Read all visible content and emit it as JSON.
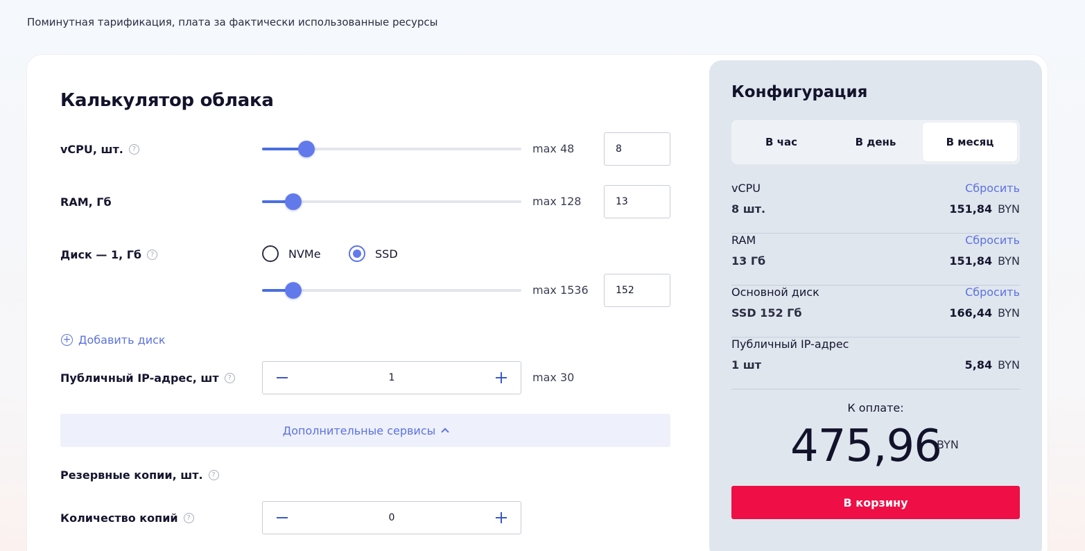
{
  "header": {
    "subtitle": "Поминутная тарификация, плата за фактически использованные ресурсы"
  },
  "calculator": {
    "title": "Калькулятор облака",
    "vcpu": {
      "label": "vCPU, шт.",
      "max": "max 48",
      "value": "8",
      "fraction": 0.17
    },
    "ram": {
      "label": "RAM, Гб",
      "max": "max 128",
      "value": "13",
      "fraction": 0.12
    },
    "disk": {
      "label": "Диск — 1, Гб",
      "types": [
        "NVMe",
        "SSD"
      ],
      "selected": "SSD",
      "max": "max 1536",
      "value": "152",
      "fraction": 0.12
    },
    "add_disk": "Добавить диск",
    "public_ip": {
      "label": "Публичный IP-адрес, шт",
      "value": "1",
      "max": "max 30"
    },
    "extra_services": "Дополнительные сервисы",
    "backups": {
      "label": "Резервные копии, шт."
    },
    "copies": {
      "label": "Количество копий",
      "value": "0"
    }
  },
  "configuration": {
    "title": "Конфигурация",
    "periods": [
      "В час",
      "В день",
      "В месяц"
    ],
    "active_period": "В месяц",
    "items": [
      {
        "name": "vCPU",
        "reset": "Сбросить",
        "detail": "8 шт.",
        "price": "151,84",
        "currency": "BYN"
      },
      {
        "name": "RAM",
        "reset": "Сбросить",
        "detail": "13 Гб",
        "price": "151,84",
        "currency": "BYN"
      },
      {
        "name": "Основной диск",
        "reset": "Сбросить",
        "detail": "SSD 152 Гб",
        "price": "166,44",
        "currency": "BYN"
      },
      {
        "name": "Публичный IP-адрес",
        "detail": "1 шт",
        "price": "5,84",
        "currency": "BYN"
      }
    ],
    "total_label": "К оплате:",
    "total": "475,96",
    "total_currency": "BYN",
    "cart_button": "В корзину"
  },
  "colors": {
    "accent": "#5b72e0",
    "slider": "#6279ec",
    "cart": "#ef0e45",
    "panel": "#e0e6ee"
  }
}
